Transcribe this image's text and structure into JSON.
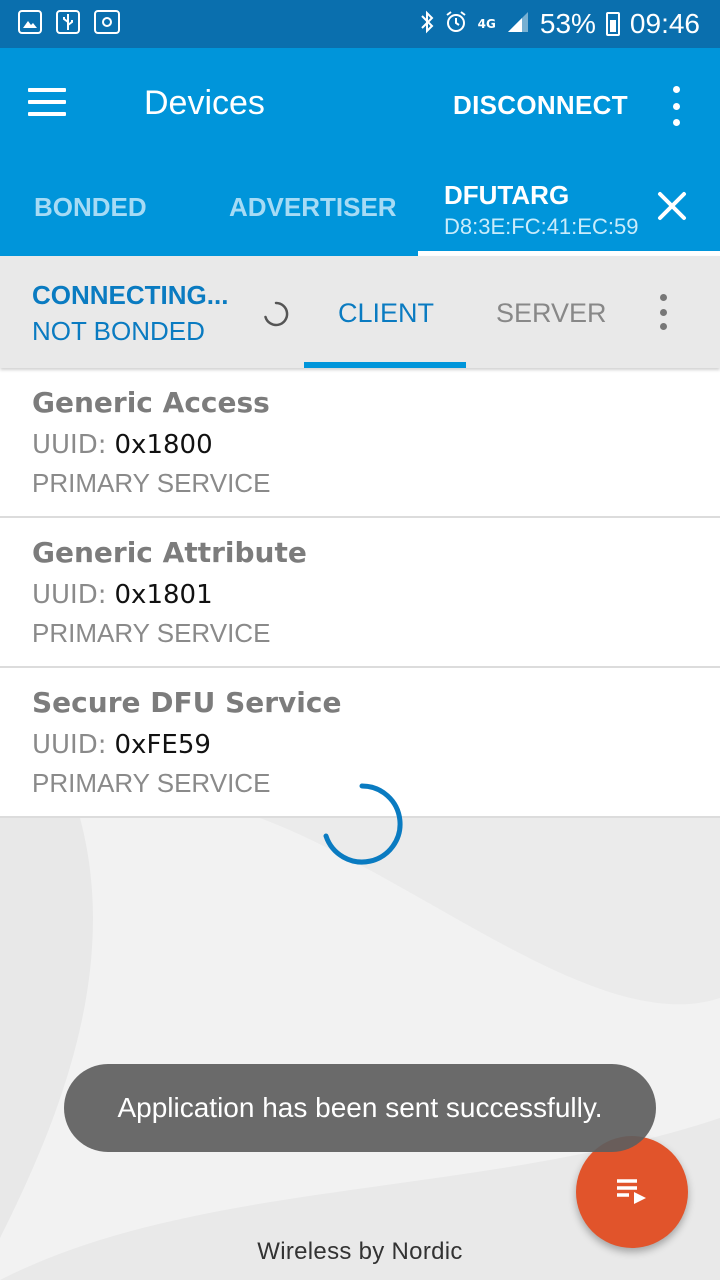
{
  "status_bar": {
    "left_icons": [
      "image-icon",
      "usb-icon",
      "screen-share-icon"
    ],
    "right_icons": [
      "bluetooth-icon",
      "alarm-icon",
      "network-4g-icon",
      "signal-icon"
    ],
    "network": "4G",
    "battery": "53%",
    "time": "09:46"
  },
  "app_bar": {
    "title": "Devices",
    "disconnect_label": "DISCONNECT",
    "tabs": {
      "bonded": "BONDED",
      "advertiser": "ADVERTISER",
      "device_name": "DFUTARG",
      "device_address": "D8:3E:FC:41:EC:59"
    },
    "background": "#0095da"
  },
  "connection": {
    "state": "CONNECTING...",
    "bond_state": "NOT BONDED",
    "tabs": {
      "client": "CLIENT",
      "server": "SERVER"
    },
    "accent": "#0a7bc1"
  },
  "services": [
    {
      "name": "Generic Access",
      "uuid_label": "UUID:",
      "uuid": "0x1800",
      "type": "PRIMARY SERVICE"
    },
    {
      "name": "Generic Attribute",
      "uuid_label": "UUID:",
      "uuid": "0x1801",
      "type": "PRIMARY SERVICE"
    },
    {
      "name": "Secure DFU Service",
      "uuid_label": "UUID:",
      "uuid": "0xFE59",
      "type": "PRIMARY SERVICE"
    }
  ],
  "toast": "Application has been sent successfully.",
  "fab": {
    "icon": "log-list-icon",
    "color": "#e1542b"
  },
  "footer": "Wireless by Nordic"
}
